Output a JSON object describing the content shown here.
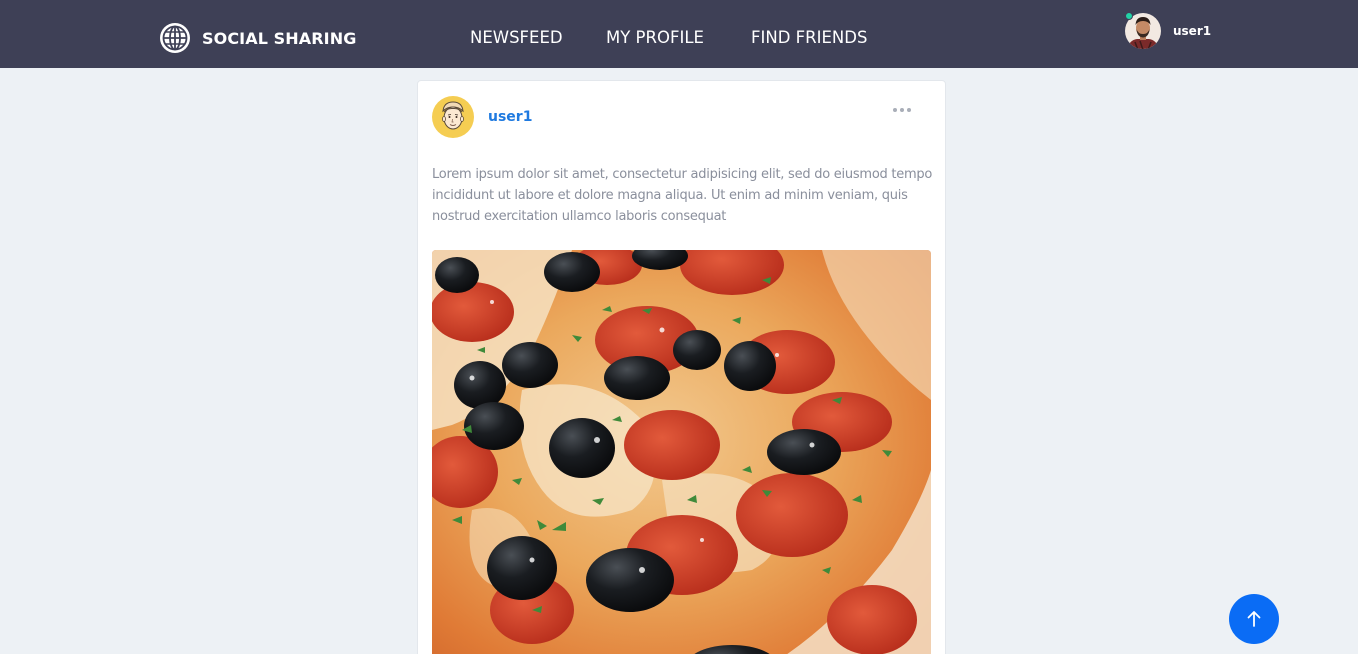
{
  "header": {
    "brand": "SOCIAL SHARING",
    "brand_icon": "globe-icon",
    "nav": {
      "newsfeed": "NEWSFEED",
      "profile": "MY PROFILE",
      "friends": "FIND FRIENDS"
    },
    "user": {
      "name": "user1",
      "status": "online",
      "status_color": "#22d3a6"
    },
    "background": "#3e4056"
  },
  "post": {
    "author": "user1",
    "more_icon": "more-horizontal-icon",
    "text": "Lorem ipsum dolor sit amet, consectetur adipisicing elit, sed do eiusmod tempo incididunt ut labore et dolore magna aliqua. Ut enim ad minim veniam, quis nostrud exercitation ullamco laboris consequat",
    "image_subject": "pepperoni-olive-pizza"
  },
  "scroll_top": {
    "icon": "arrow-up-icon",
    "color": "#0a6cf5"
  },
  "colors": {
    "page_bg": "#edf1f5",
    "link": "#1f7ae0",
    "muted_text": "#8a8f9c"
  }
}
